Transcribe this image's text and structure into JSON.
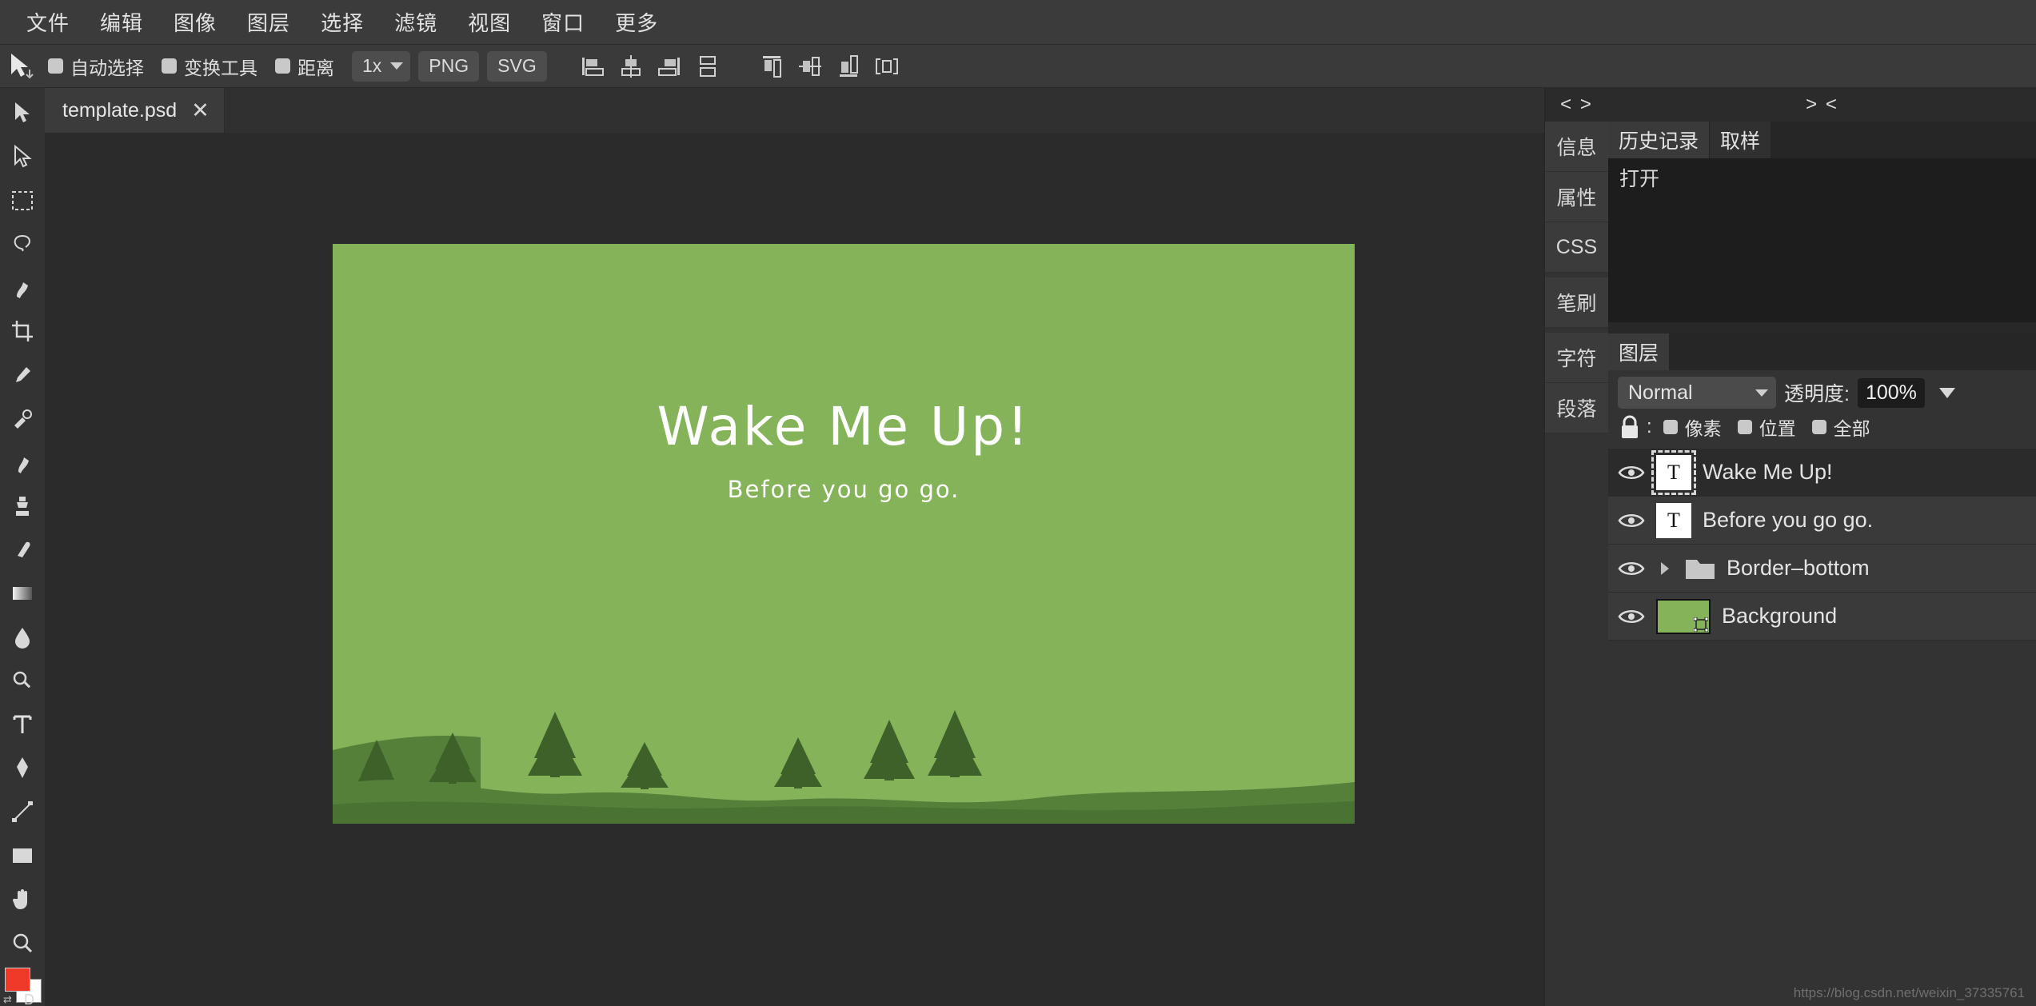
{
  "menubar": {
    "items": [
      {
        "label": "文件",
        "name": "menu-file"
      },
      {
        "label": "编辑",
        "name": "menu-edit"
      },
      {
        "label": "图像",
        "name": "menu-image"
      },
      {
        "label": "图层",
        "name": "menu-layer"
      },
      {
        "label": "选择",
        "name": "menu-select"
      },
      {
        "label": "滤镜",
        "name": "menu-filter"
      },
      {
        "label": "视图",
        "name": "menu-view"
      },
      {
        "label": "窗口",
        "name": "menu-window"
      },
      {
        "label": "更多",
        "name": "menu-more"
      }
    ]
  },
  "options_bar": {
    "tool_icon": "move-tool-icon",
    "checkboxes": [
      {
        "label": "自动选择",
        "checked": true
      },
      {
        "label": "变换工具",
        "checked": true
      },
      {
        "label": "距离",
        "checked": true
      }
    ],
    "zoom_select": "1x",
    "export_png": "PNG",
    "export_svg": "SVG",
    "align_icons": [
      "align-left-icon",
      "align-center-horizontal-icon",
      "align-right-icon",
      "distribute-vertical-icon",
      "align-top-icon",
      "align-middle-vertical-icon",
      "align-bottom-icon",
      "distribute-horizontal-icon"
    ]
  },
  "toolbox": {
    "tools": [
      {
        "name": "move-tool",
        "glyph": "arrow"
      },
      {
        "name": "path-select-tool",
        "glyph": "pathselect"
      },
      {
        "name": "marquee-tool",
        "glyph": "marquee"
      },
      {
        "name": "lasso-tool",
        "glyph": "lasso"
      },
      {
        "name": "brush-tool",
        "glyph": "brush"
      },
      {
        "name": "crop-tool",
        "glyph": "crop"
      },
      {
        "name": "eyedropper-tool",
        "glyph": "eyedropper"
      },
      {
        "name": "healing-brush-tool",
        "glyph": "healing"
      },
      {
        "name": "paint-brush-tool",
        "glyph": "paintbrush"
      },
      {
        "name": "clone-stamp-tool",
        "glyph": "stamp"
      },
      {
        "name": "eraser-tool",
        "glyph": "eraser"
      },
      {
        "name": "gradient-tool",
        "glyph": "gradient"
      },
      {
        "name": "blur-tool",
        "glyph": "blur"
      },
      {
        "name": "dodge-tool",
        "glyph": "dodge"
      },
      {
        "name": "type-tool",
        "glyph": "type"
      },
      {
        "name": "pen-tool",
        "glyph": "pen"
      },
      {
        "name": "shape-transform-tool",
        "glyph": "transform"
      },
      {
        "name": "rectangle-tool",
        "glyph": "rectangle"
      },
      {
        "name": "hand-tool",
        "glyph": "hand"
      },
      {
        "name": "zoom-tool",
        "glyph": "zoom"
      }
    ],
    "foreground_color": "#ef3a2a",
    "background_color": "#ffffff",
    "swatch_letter": "D"
  },
  "document": {
    "tab_title": "template.psd",
    "close_label": "✕"
  },
  "canvas": {
    "background_color": "#84b359",
    "hill_color": "#54803a",
    "tree_color": "#3d6129",
    "title": "Wake Me Up!",
    "subtitle": "Before you go go."
  },
  "vertical_rail": {
    "collapse_label": "< >",
    "tabs": [
      "信息",
      "属性",
      "CSS",
      "笔刷",
      "字符",
      "段落"
    ]
  },
  "history_panel": {
    "collapse_label": "> <",
    "tabs": [
      {
        "label": "历史记录",
        "active": true
      },
      {
        "label": "取样",
        "active": false
      }
    ],
    "items": [
      "打开"
    ]
  },
  "layers_panel": {
    "tab_label": "图层",
    "blend_mode": "Normal",
    "opacity_label": "透明度:",
    "opacity_value": "100%",
    "lock_label": ":",
    "lock_options": [
      {
        "label": "像素",
        "checked": true
      },
      {
        "label": "位置",
        "checked": true
      },
      {
        "label": "全部",
        "checked": true
      }
    ],
    "layers": [
      {
        "name": "Wake Me Up!",
        "type": "text",
        "visible": true,
        "selected": true
      },
      {
        "name": "Before you go go.",
        "type": "text",
        "visible": true,
        "selected": false
      },
      {
        "name": "Border–bottom",
        "type": "group",
        "visible": true,
        "selected": false
      },
      {
        "name": "Background",
        "type": "image",
        "visible": true,
        "selected": false,
        "thumb_color": "#84b359"
      }
    ]
  },
  "watermark": {
    "text": "https://blog.csdn.net/weixin_37335761"
  }
}
